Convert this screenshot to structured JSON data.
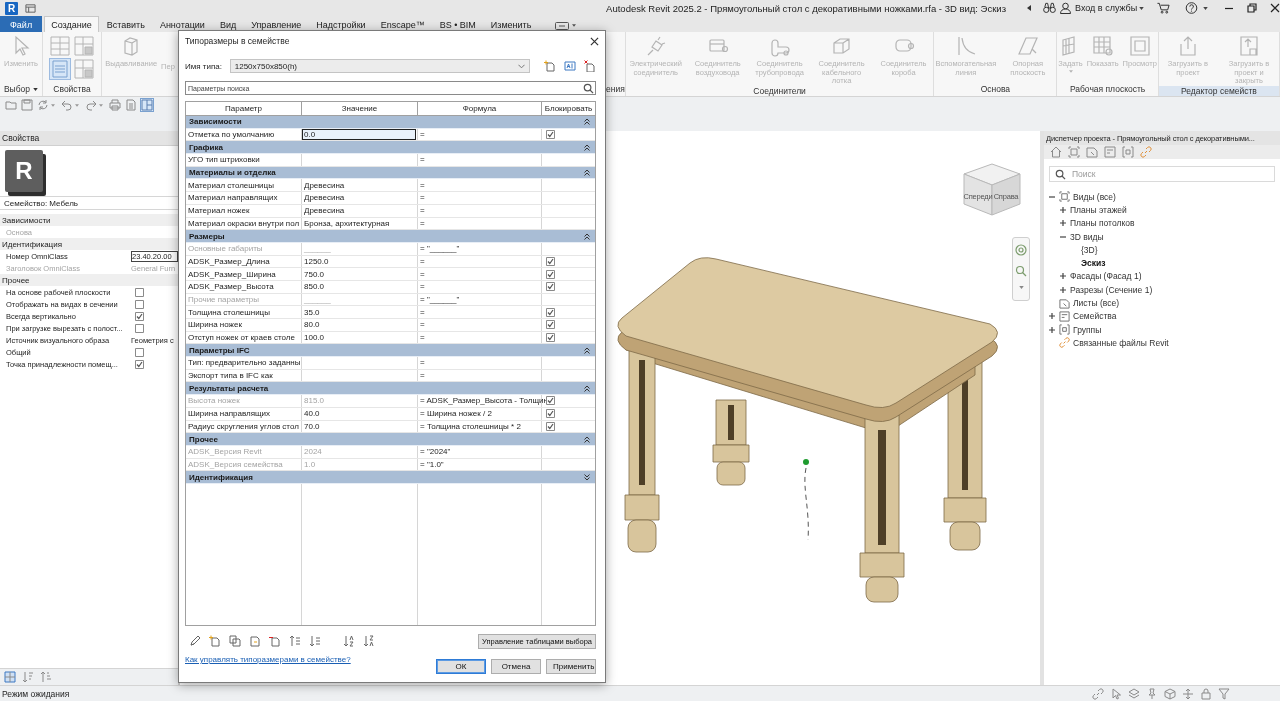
{
  "title_bar": {
    "logo": "R",
    "title": "Autodesk Revit 2025.2 - Прямоугольный стол с декоративными ножками.rfa - 3D вид: Эскиз",
    "sign_in": "Вход в службы"
  },
  "ribbon_tabs": [
    {
      "label": "Файл",
      "kind": "file",
      "selected": false
    },
    {
      "label": "Создание",
      "kind": "tab",
      "selected": true
    },
    {
      "label": "Вставить",
      "kind": "tab",
      "selected": false
    },
    {
      "label": "Аннотации",
      "kind": "tab",
      "selected": false
    },
    {
      "label": "Вид",
      "kind": "tab",
      "selected": false
    },
    {
      "label": "Управление",
      "kind": "tab",
      "selected": false
    },
    {
      "label": "Надстройки",
      "kind": "tab",
      "selected": false
    },
    {
      "label": "Enscape™",
      "kind": "tab",
      "selected": false
    },
    {
      "label": "BS • BIM",
      "kind": "tab",
      "selected": false
    },
    {
      "label": "Изменить",
      "kind": "tab",
      "selected": false
    }
  ],
  "ribbon_left": {
    "modify_button": {
      "label": "Изменить",
      "disabled": true
    },
    "select_panel": "Выбор",
    "properties_panel": "Свойства",
    "buttons": [
      {
        "label": "Выдавливание",
        "disabled": true
      },
      {
        "label": "Пер",
        "disabled": true
      }
    ]
  },
  "ribbon_right": {
    "cut_panel": "ения",
    "panels": [
      {
        "title": "Соединители",
        "highlighted": false,
        "buttons": [
          {
            "label": "Электрический соединитель",
            "kind": "electrical",
            "disabled": true
          },
          {
            "label": "Соединитель воздуховода",
            "kind": "duct",
            "disabled": true
          },
          {
            "label": "Соединитель трубопровода",
            "kind": "pipe",
            "disabled": true
          },
          {
            "label": "Соединитель кабельного лотка",
            "kind": "cable-tray",
            "disabled": true
          },
          {
            "label": "Соединитель короба",
            "kind": "conduit",
            "disabled": true
          }
        ]
      },
      {
        "title": "Основа",
        "highlighted": false,
        "buttons": [
          {
            "label": "Вспомогательная линия",
            "kind": "ref-line",
            "disabled": true
          },
          {
            "label": "Опорная плоскость",
            "kind": "ref-plane",
            "disabled": true
          }
        ]
      },
      {
        "title": "Рабочая плоскость",
        "highlighted": false,
        "buttons": [
          {
            "label": "Задать",
            "kind": "set",
            "disabled": true
          },
          {
            "label": "Показать",
            "kind": "show",
            "disabled": true
          },
          {
            "label": "Просмотр",
            "kind": "viewer",
            "disabled": true
          }
        ]
      },
      {
        "title": "Редактор семейств",
        "highlighted": true,
        "buttons": [
          {
            "label": "Загрузить в проект",
            "kind": "load",
            "disabled": true
          },
          {
            "label": "Загрузить в проект и закрыть",
            "kind": "load-close",
            "disabled": true
          }
        ]
      }
    ]
  },
  "properties": {
    "title": "Свойства",
    "type_logo": "R",
    "family": "Семейство: Мебель",
    "groups": [
      {
        "title": "Зависимости",
        "rows": [
          {
            "name": "Основа",
            "kind": "text",
            "disabled": true
          }
        ]
      },
      {
        "title": "Идентификация",
        "rows": [
          {
            "name": "Номер OmniClass",
            "kind": "field",
            "value": "23.40.20.00",
            "disabled": false
          },
          {
            "name": "Заголовок OmniClass",
            "kind": "text",
            "value": "General Furn",
            "disabled": true
          }
        ]
      },
      {
        "title": "Прочее",
        "rows": [
          {
            "name": "На основе рабочей плоскости",
            "kind": "checkbox",
            "checked": false,
            "disabled": false
          },
          {
            "name": "Отображать на видах в сечении",
            "kind": "checkbox",
            "checked": false,
            "disabled": false
          },
          {
            "name": "Всегда вертикально",
            "kind": "checkbox",
            "checked": true,
            "disabled": false
          },
          {
            "name": "При загрузке вырезать с полост...",
            "kind": "checkbox",
            "checked": false,
            "disabled": false
          },
          {
            "name": "Источник визуального образа",
            "kind": "text",
            "value": "Геометрия с",
            "disabled": false
          },
          {
            "name": "Общий",
            "kind": "checkbox",
            "checked": false,
            "disabled": false
          },
          {
            "name": "Точка принадлежности помещ...",
            "kind": "checkbox",
            "checked": true,
            "disabled": false
          }
        ]
      }
    ]
  },
  "view": {
    "view_cube": {
      "faces": [
        "Спереди",
        "Справа"
      ]
    }
  },
  "project_browser": {
    "title": "Диспетчер проекта - Прямоугольный стол с декоративными...",
    "search_placeholder": "Поиск",
    "tree": [
      {
        "label": "Виды (все)",
        "kind": "views",
        "expanded": true,
        "selected": false,
        "children": [
          {
            "label": "Планы этажей",
            "expanded": false,
            "selected": false
          },
          {
            "label": "Планы потолков",
            "expanded": false,
            "selected": false
          },
          {
            "label": "3D виды",
            "expanded": true,
            "selected": false,
            "children": [
              {
                "label": "{3D}",
                "selected": false
              },
              {
                "label": "Эскиз",
                "selected": true
              }
            ]
          },
          {
            "label": "Фасады (Фасад 1)",
            "expanded": false,
            "selected": false
          },
          {
            "label": "Разрезы (Сечение 1)",
            "expanded": false,
            "selected": false
          }
        ]
      },
      {
        "label": "Листы (все)",
        "kind": "sheets",
        "selected": false
      },
      {
        "label": "Семейства",
        "kind": "families",
        "expanded": false,
        "selected": false
      },
      {
        "label": "Группы",
        "kind": "groups",
        "expanded": false,
        "selected": false
      },
      {
        "label": "Связанные файлы Revit",
        "kind": "links",
        "selected": false
      }
    ]
  },
  "dialog": {
    "title": "Типоразмеры в семействе",
    "type_label": "Имя типа:",
    "type_value": "1250x750x850(h)",
    "search_placeholder": "Параметры поиска",
    "columns": [
      "Параметр",
      "Значение",
      "Формула",
      "Блокировать"
    ],
    "groups": [
      {
        "title": "Зависимости",
        "expanded": true,
        "rows": [
          {
            "name": "Отметка по умолчанию",
            "value": "0.0",
            "formula": "=",
            "locked": true,
            "disabled": false,
            "selected": true
          }
        ]
      },
      {
        "title": "Графика",
        "expanded": true,
        "rows": [
          {
            "name": "УГО тип штриховки",
            "formula": "=",
            "locked": false,
            "disabled": false,
            "selected": false
          }
        ]
      },
      {
        "title": "Материалы и отделка",
        "expanded": true,
        "rows": [
          {
            "name": "Материал столешницы",
            "value": "Древесина",
            "formula": "=",
            "locked": false,
            "disabled": false,
            "selected": false
          },
          {
            "name": "Материал направлящих",
            "value": "Древесина",
            "formula": "=",
            "locked": false,
            "disabled": false,
            "selected": false
          },
          {
            "name": "Материал ножек",
            "value": "Древесина",
            "formula": "=",
            "locked": false,
            "disabled": false,
            "selected": false
          },
          {
            "name": "Материал окраски внутри пол",
            "value": "Бронза, архитектурная",
            "formula": "=",
            "locked": false,
            "disabled": false,
            "selected": false
          }
        ]
      },
      {
        "title": "Размеры",
        "expanded": true,
        "rows": [
          {
            "name": "Основные габариты",
            "value": "______",
            "formula": "= \"______\"",
            "locked": false,
            "disabled": true,
            "selected": false
          },
          {
            "name": "ADSK_Размер_Длина",
            "value": "1250.0",
            "formula": "=",
            "locked": true,
            "disabled": false,
            "selected": false
          },
          {
            "name": "ADSK_Размер_Ширина",
            "value": "750.0",
            "formula": "=",
            "locked": true,
            "disabled": false,
            "selected": false
          },
          {
            "name": "ADSK_Размер_Высота",
            "value": "850.0",
            "formula": "=",
            "locked": true,
            "disabled": false,
            "selected": false
          },
          {
            "name": "Прочие параметры",
            "value": "______",
            "formula": "= \"______\"",
            "locked": false,
            "disabled": true,
            "selected": false
          },
          {
            "name": "Толщина столешницы",
            "value": "35.0",
            "formula": "=",
            "locked": true,
            "disabled": false,
            "selected": false
          },
          {
            "name": "Ширина ножек",
            "value": "80.0",
            "formula": "=",
            "locked": true,
            "disabled": false,
            "selected": false
          },
          {
            "name": "Отступ ножек от краев столе",
            "value": "100.0",
            "formula": "=",
            "locked": true,
            "disabled": false,
            "selected": false
          }
        ]
      },
      {
        "title": "Параметры IFC",
        "expanded": true,
        "rows": [
          {
            "name": "Тип: предварительно заданны",
            "formula": "=",
            "locked": false,
            "disabled": false,
            "selected": false
          },
          {
            "name": "Экспорт типа в IFC как",
            "formula": "=",
            "locked": false,
            "disabled": false,
            "selected": false
          }
        ]
      },
      {
        "title": "Результаты расчета",
        "expanded": true,
        "rows": [
          {
            "name": "Высота ножек",
            "value": "815.0",
            "formula": "= ADSK_Размер_Высота - Толщин",
            "locked": true,
            "disabled": true,
            "selected": false
          },
          {
            "name": "Ширина направлящих",
            "value": "40.0",
            "formula": "= Ширина ножек / 2",
            "locked": true,
            "disabled": false,
            "selected": false
          },
          {
            "name": "Радиус скругления углов стол",
            "value": "70.0",
            "formula": "= Толщина столешницы * 2",
            "locked": true,
            "disabled": false,
            "selected": false
          }
        ]
      },
      {
        "title": "Прочее",
        "expanded": true,
        "rows": [
          {
            "name": "ADSK_Версия Revit",
            "value": "2024",
            "formula": "= \"2024\"",
            "locked": false,
            "disabled": true,
            "selected": false
          },
          {
            "name": "ADSK_Версия семейства",
            "value": "1.0",
            "formula": "= \"1.0\"",
            "locked": false,
            "disabled": true,
            "selected": false
          }
        ]
      },
      {
        "title": "Идентификация",
        "expanded": false
      }
    ],
    "manage_button": "Управление таблицами выбора",
    "help_link": "Как управлять типоразмерами в семействе?",
    "buttons": [
      {
        "label": "ОК",
        "kind": "default"
      },
      {
        "label": "Отмена",
        "kind": "normal"
      },
      {
        "label": "Применить",
        "kind": "normal"
      }
    ]
  },
  "status_bar": {
    "text": "Режим ожидания"
  }
}
